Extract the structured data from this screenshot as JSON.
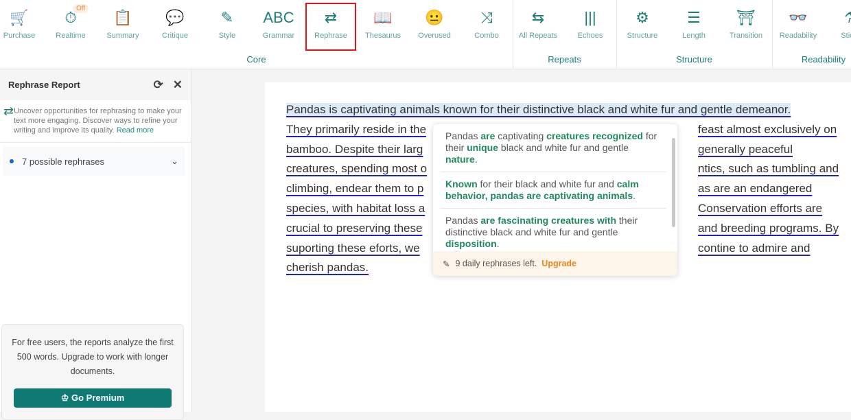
{
  "toolbar": {
    "items": [
      {
        "label": "Purchase",
        "icon": "🛒"
      },
      {
        "label": "Realtime",
        "icon": "⏱",
        "badge": "Off"
      },
      {
        "label": "Summary",
        "icon": "📋"
      },
      {
        "label": "Critique",
        "icon": "💬"
      },
      {
        "label": "Style",
        "icon": "✎"
      },
      {
        "label": "Grammar",
        "icon": "ABC"
      },
      {
        "label": "Rephrase",
        "icon": "⇄",
        "active": true
      },
      {
        "label": "Thesaurus",
        "icon": "📖"
      },
      {
        "label": "Overused",
        "icon": "😐"
      },
      {
        "label": "Combo",
        "icon": "⤨"
      },
      {
        "label": "All Repeats",
        "icon": "⇆"
      },
      {
        "label": "Echoes",
        "icon": "|||"
      },
      {
        "label": "Structure",
        "icon": "⚙"
      },
      {
        "label": "Length",
        "icon": "☰"
      },
      {
        "label": "Transition",
        "icon": "⛩"
      },
      {
        "label": "Readability",
        "icon": "👓"
      },
      {
        "label": "Sticky",
        "icon": "⚗"
      }
    ],
    "groups": [
      "Core",
      "Repeats",
      "Structure",
      "Readability"
    ]
  },
  "sidebar": {
    "title": "Rephrase Report",
    "description": "Uncover opportunities for rephrasing to make your text more engaging. Discover ways to refine your writing and improve its quality.",
    "read_more": "Read more",
    "count_label": "7 possible rephrases",
    "promo_text": "For free users, the reports analyze the first 500 words. Upgrade to work with longer documents.",
    "premium_button": "Go Premium",
    "premium_icon": "♔"
  },
  "document": {
    "lines": [
      {
        "left": "Pandas is captivating animals known for their distinctive black and white fur and gentle demeanor.",
        "right": ""
      },
      {
        "left": "They primarily reside in the",
        "right": "feast almost exclusively on"
      },
      {
        "left": "bamboo. Despite their larg",
        "right": "generally peaceful"
      },
      {
        "left": "creatures, spending most o",
        "right": "ntics, such as tumbling and"
      },
      {
        "left": "climbing, endear them to p",
        "right": "as are an endangered"
      },
      {
        "left": "species, with habitat loss a",
        "right": "Conservation efforts are"
      },
      {
        "left": "crucial to preserving these",
        "right": "and breeding programs. By"
      },
      {
        "left": "suporting these eforts, we",
        "right": "contine to admire and"
      },
      {
        "left": "cherish pandas.",
        "right": ""
      }
    ]
  },
  "popup": {
    "options": [
      [
        [
          "Pandas ",
          0
        ],
        [
          "are",
          1
        ],
        [
          " captivating ",
          0
        ],
        [
          "creatures recognized",
          1
        ],
        [
          " for their ",
          0
        ],
        [
          "unique",
          1
        ],
        [
          " black and white fur and gentle ",
          0
        ],
        [
          "nature",
          1
        ],
        [
          ".",
          0
        ]
      ],
      [
        [
          "Known",
          1
        ],
        [
          " for their black and white fur and ",
          0
        ],
        [
          "calm behavior, pandas are captivating animals",
          1
        ],
        [
          ".",
          0
        ]
      ],
      [
        [
          "Pandas ",
          0
        ],
        [
          "are fascinating creatures with",
          1
        ],
        [
          " their distinctive black and white fur and gentle ",
          0
        ],
        [
          "disposition",
          1
        ],
        [
          ".",
          0
        ]
      ]
    ],
    "footer_text": "9 daily rephrases left.",
    "upgrade": "Upgrade"
  },
  "colors": {
    "accent": "#1d7f7a",
    "highlight": "#1f8a5e",
    "underline": "#2020c8",
    "upgrade": "#e8871e"
  }
}
